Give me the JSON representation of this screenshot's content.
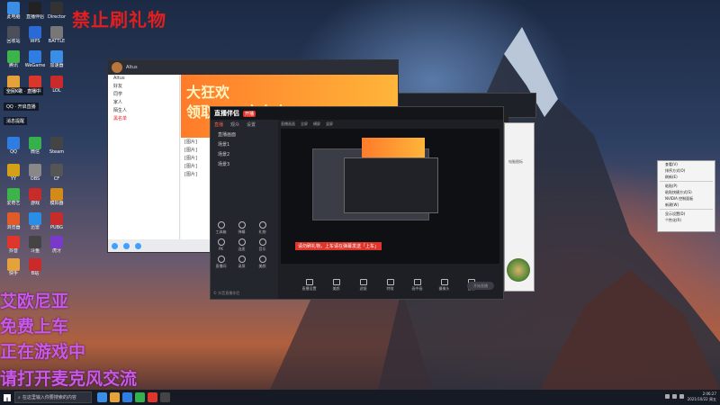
{
  "screen_notice": "禁止刷礼物",
  "overlay_lines": [
    "艾欧尼亚",
    "免费上车",
    "正在游戏中",
    "请打开麦克风交流"
  ],
  "side_tips": [
    "全民K歌 · 直播中",
    "QQ · 开启直播",
    "消息提醒"
  ],
  "qq": {
    "nickname": "Altus",
    "banner_line1": "大狂欢",
    "banner_line2": "领取500京东卡",
    "contacts": [
      "Altus",
      "好友",
      "同学",
      "家人",
      "陌生人",
      "黑名单"
    ],
    "chat_lines": [
      "[图片]",
      "[图片]",
      "[图片]",
      "[图片]",
      "[图片]"
    ]
  },
  "stream": {
    "logo": "直播伴侣",
    "tag": "开播",
    "left_tabs": [
      "直播",
      "观众",
      "设置"
    ],
    "scene_items": [
      "直播画面",
      "场景1",
      "场景2",
      "场景3"
    ],
    "tools": [
      "工具箱",
      "弹幕",
      "礼物",
      "PK",
      "连麦",
      "音乐",
      "直播间",
      "录屏",
      "美颜"
    ],
    "bottom_hint": "© 抖音直播伴侣",
    "preview_header": [
      "直播画面",
      "全屏",
      "横屏",
      "竖屏"
    ],
    "red_line": "请勿刷礼物，上车请在弹幕发送「上车」",
    "bottom_buttons": [
      "直播设置",
      "美颜",
      "滤镜",
      "特效",
      "画中画",
      "摄像头",
      "音效"
    ],
    "start_button": "开始直播"
  },
  "white_side_text": "电脑图标",
  "context_menu": [
    "查看(V)",
    "排序方式(O)",
    "刷新(E)",
    "粘贴(P)",
    "粘贴快捷方式(S)",
    "NVIDIA 控制面板",
    "新建(W)",
    "显示设置(D)",
    "个性化(R)"
  ],
  "taskbar": {
    "search_placeholder": "在这里输入你要搜索的内容",
    "clock_time": "2:06:27",
    "clock_date": "2021/10/22 周五"
  },
  "colors": {
    "notice_red": "#e02020",
    "overlay_purple": "#c85ae6",
    "accent_orange": "#ff7b2a",
    "stream_red": "#e0352b"
  }
}
